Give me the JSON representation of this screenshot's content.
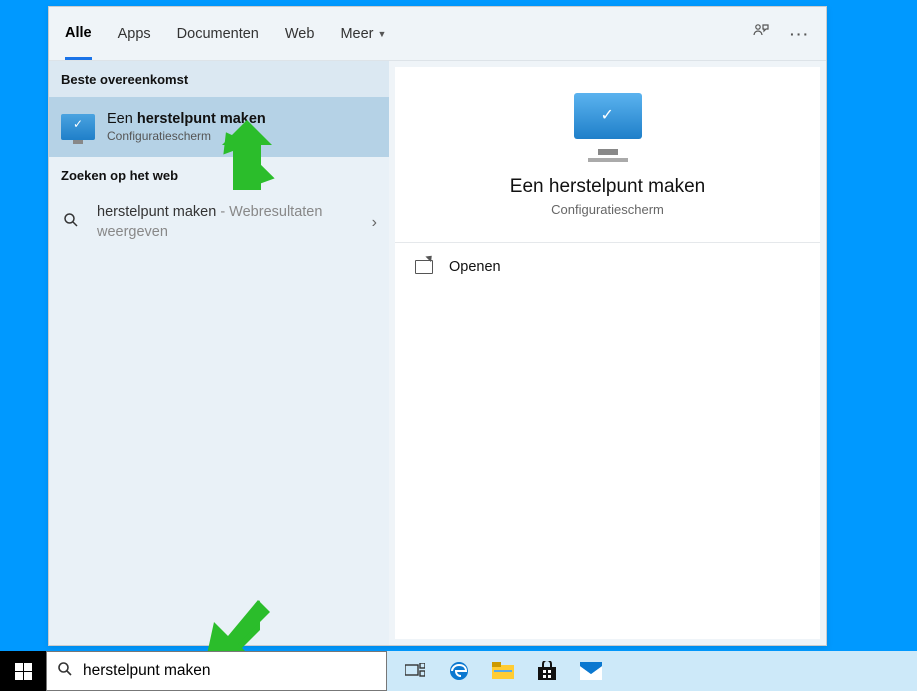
{
  "tabs": {
    "all": "Alle",
    "apps": "Apps",
    "documents": "Documenten",
    "web": "Web",
    "more": "Meer"
  },
  "sections": {
    "best_match": "Beste overeenkomst",
    "search_web": "Zoeken op het web"
  },
  "best_match": {
    "title_prefix": "Een ",
    "title_bold": "herstelpunt maken",
    "subtitle": "Configuratiescherm"
  },
  "web_result": {
    "query": "herstelpunt maken",
    "suffix": " - Webresultaten weergeven"
  },
  "preview": {
    "title": "Een herstelpunt maken",
    "subtitle": "Configuratiescherm",
    "open_label": "Openen"
  },
  "searchbox": {
    "value": "herstelpunt maken"
  }
}
